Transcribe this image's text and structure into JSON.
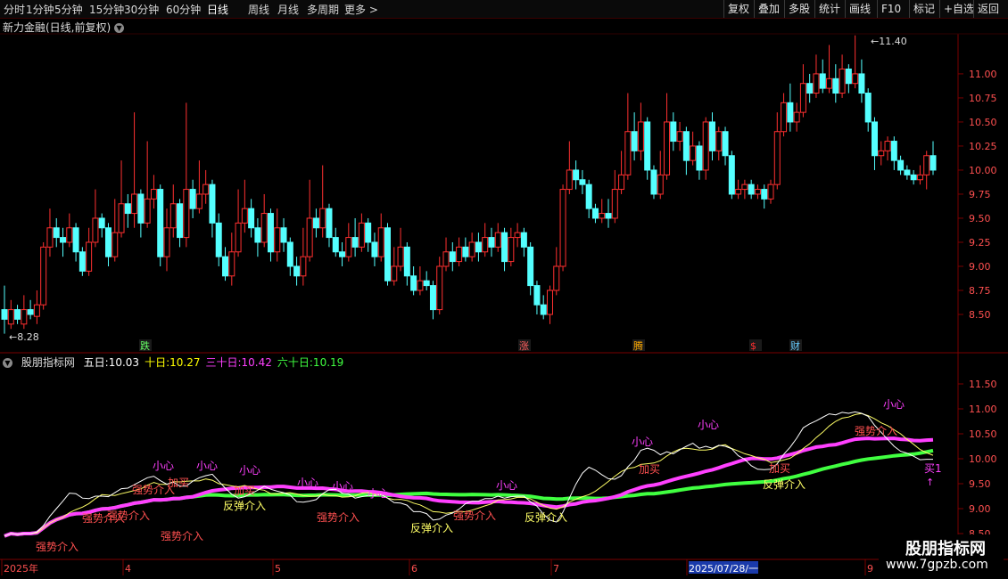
{
  "toolbar": {
    "tabs": [
      "分时",
      "1分钟",
      "5分钟",
      "15分钟",
      "30分钟",
      "60分钟",
      "日线",
      "周线",
      "月线",
      "多周期",
      "更多 >"
    ],
    "active_tab": "日线",
    "right_buttons": [
      "复权",
      "叠加",
      "多股",
      "统计",
      "画线",
      "F10",
      "标记",
      "+自选",
      "返回"
    ]
  },
  "chart_title": "新力金融(日线,前复权)",
  "indicator": {
    "name": "股朋指标网",
    "values": [
      {
        "label": "五日:",
        "value": "10.03",
        "color": "#ffffff"
      },
      {
        "label": "十日:",
        "value": "10.27",
        "color": "#ffff00"
      },
      {
        "label": "三十日:",
        "value": "10.42",
        "color": "#ff40ff"
      },
      {
        "label": "六十日:",
        "value": "10.19",
        "color": "#40ff40"
      }
    ]
  },
  "colors": {
    "up": "#ff3030",
    "down": "#54ffff",
    "ma5": "#ffffff",
    "ma10": "#ffff66",
    "ma30": "#ff40ff",
    "ma60": "#40ff40",
    "axis": "#7a0000"
  },
  "price_axis": [
    "11.00",
    "10.75",
    "10.50",
    "10.25",
    "10.00",
    "9.75",
    "9.50",
    "9.25",
    "9.00",
    "8.75",
    "8.50"
  ],
  "ind_axis": [
    "11.50",
    "11.00",
    "10.50",
    "10.00",
    "9.50",
    "9.00",
    "8.50"
  ],
  "max_label": "11.40",
  "min_label": "8.28",
  "events": [
    "跌",
    "涨",
    "腾",
    "$",
    "财"
  ],
  "date_axis": [
    "2025年",
    "4",
    "5",
    "6",
    "7",
    "2025/07/28/一",
    "9"
  ],
  "signals": {
    "strong": "强势介入",
    "rebound": "反弹介入",
    "add": "加买",
    "careful": "小心",
    "buy": "买1"
  },
  "brand": {
    "name": "股朋指标网",
    "url": "www.7gpzb.com"
  },
  "chart_data": {
    "type": "candlestick",
    "ylim": [
      8.3,
      11.5
    ],
    "candles": [
      [
        8.55,
        8.45,
        8.8,
        8.3
      ],
      [
        8.4,
        8.55,
        8.65,
        8.35
      ],
      [
        8.55,
        8.45,
        8.6,
        8.4
      ],
      [
        8.4,
        8.55,
        8.7,
        8.35
      ],
      [
        8.55,
        8.5,
        8.65,
        8.45
      ],
      [
        8.48,
        8.6,
        8.75,
        8.4
      ],
      [
        8.6,
        9.2,
        9.25,
        8.55
      ],
      [
        9.2,
        9.4,
        9.6,
        9.1
      ],
      [
        9.4,
        9.3,
        9.5,
        9.2
      ],
      [
        9.3,
        9.25,
        9.4,
        9.1
      ],
      [
        9.25,
        9.4,
        9.55,
        9.2
      ],
      [
        9.4,
        9.15,
        9.45,
        9.05
      ],
      [
        9.15,
        8.95,
        9.2,
        8.9
      ],
      [
        8.95,
        9.25,
        9.4,
        8.9
      ],
      [
        9.25,
        9.5,
        9.8,
        9.2
      ],
      [
        9.5,
        9.4,
        9.55,
        9.3
      ],
      [
        9.4,
        9.1,
        9.45,
        9.0
      ],
      [
        9.1,
        9.35,
        9.7,
        9.05
      ],
      [
        9.35,
        9.65,
        10.1,
        9.3
      ],
      [
        9.65,
        9.55,
        9.75,
        9.4
      ],
      [
        9.55,
        9.75,
        10.6,
        9.4
      ],
      [
        9.75,
        9.45,
        9.8,
        9.3
      ],
      [
        9.45,
        9.7,
        10.3,
        9.4
      ],
      [
        9.7,
        9.8,
        9.95,
        9.6
      ],
      [
        9.8,
        9.1,
        9.85,
        9.0
      ],
      [
        9.1,
        9.4,
        9.6,
        8.95
      ],
      [
        9.4,
        9.65,
        9.85,
        9.3
      ],
      [
        9.65,
        9.3,
        9.7,
        9.2
      ],
      [
        9.3,
        9.8,
        10.7,
        9.2
      ],
      [
        9.8,
        9.6,
        9.9,
        9.5
      ],
      [
        9.6,
        9.75,
        10.1,
        9.55
      ],
      [
        9.75,
        9.85,
        10.0,
        9.65
      ],
      [
        9.85,
        9.45,
        9.9,
        9.3
      ],
      [
        9.45,
        9.1,
        9.55,
        9.0
      ],
      [
        9.1,
        8.9,
        9.2,
        8.85
      ],
      [
        8.9,
        9.15,
        9.35,
        8.8
      ],
      [
        9.15,
        9.45,
        9.8,
        9.1
      ],
      [
        9.45,
        9.6,
        9.9,
        9.35
      ],
      [
        9.6,
        9.4,
        9.7,
        9.3
      ],
      [
        9.4,
        9.25,
        9.5,
        9.1
      ],
      [
        9.25,
        9.55,
        9.75,
        9.2
      ],
      [
        9.55,
        9.15,
        9.6,
        9.05
      ],
      [
        9.15,
        9.4,
        9.6,
        9.05
      ],
      [
        9.4,
        9.25,
        9.5,
        9.15
      ],
      [
        9.25,
        9.0,
        9.3,
        8.9
      ],
      [
        9.0,
        8.9,
        9.1,
        8.8
      ],
      [
        8.9,
        9.1,
        9.4,
        8.8
      ],
      [
        9.1,
        9.5,
        9.9,
        9.05
      ],
      [
        9.5,
        9.4,
        9.6,
        9.3
      ],
      [
        9.4,
        9.6,
        10.05,
        9.3
      ],
      [
        9.6,
        9.3,
        9.65,
        9.2
      ],
      [
        9.3,
        9.15,
        9.4,
        9.1
      ],
      [
        9.15,
        9.1,
        9.25,
        9.0
      ],
      [
        9.1,
        9.3,
        9.45,
        9.05
      ],
      [
        9.3,
        9.2,
        9.5,
        9.1
      ],
      [
        9.2,
        9.45,
        9.55,
        9.15
      ],
      [
        9.45,
        9.25,
        9.5,
        9.15
      ],
      [
        9.25,
        9.1,
        9.35,
        9.0
      ],
      [
        9.1,
        9.4,
        9.55,
        9.05
      ],
      [
        9.4,
        8.85,
        9.45,
        8.8
      ],
      [
        8.85,
        9.0,
        9.2,
        8.8
      ],
      [
        9.0,
        9.2,
        9.4,
        8.95
      ],
      [
        9.2,
        8.9,
        9.25,
        8.8
      ],
      [
        8.9,
        8.75,
        9.0,
        8.7
      ],
      [
        8.75,
        8.85,
        9.0,
        8.7
      ],
      [
        8.85,
        8.8,
        8.95,
        8.75
      ],
      [
        8.8,
        8.55,
        8.85,
        8.45
      ],
      [
        8.55,
        9.0,
        9.1,
        8.5
      ],
      [
        9.0,
        9.15,
        9.3,
        8.95
      ],
      [
        9.15,
        9.05,
        9.25,
        8.95
      ],
      [
        9.05,
        9.2,
        9.3,
        9.0
      ],
      [
        9.2,
        9.1,
        9.3,
        9.05
      ],
      [
        9.1,
        9.25,
        9.35,
        9.05
      ],
      [
        9.25,
        9.15,
        9.35,
        9.05
      ],
      [
        9.15,
        9.3,
        9.45,
        9.1
      ],
      [
        9.3,
        9.2,
        9.4,
        9.1
      ],
      [
        9.2,
        9.35,
        9.45,
        9.15
      ],
      [
        9.35,
        9.05,
        9.4,
        8.95
      ],
      [
        9.05,
        9.3,
        9.4,
        9.0
      ],
      [
        9.3,
        9.35,
        9.45,
        9.2
      ],
      [
        9.35,
        9.2,
        9.4,
        9.1
      ],
      [
        9.2,
        8.8,
        9.25,
        8.7
      ],
      [
        8.8,
        8.6,
        8.85,
        8.5
      ],
      [
        8.6,
        8.5,
        8.7,
        8.45
      ],
      [
        8.5,
        8.75,
        8.8,
        8.4
      ],
      [
        8.75,
        9.0,
        9.2,
        8.7
      ],
      [
        9.0,
        9.8,
        9.85,
        8.95
      ],
      [
        9.8,
        10.0,
        10.3,
        9.75
      ],
      [
        10.0,
        9.9,
        10.1,
        9.8
      ],
      [
        9.9,
        9.85,
        10.0,
        9.75
      ],
      [
        9.85,
        9.6,
        9.9,
        9.5
      ],
      [
        9.6,
        9.5,
        9.65,
        9.45
      ],
      [
        9.5,
        9.55,
        9.7,
        9.45
      ],
      [
        9.55,
        9.5,
        9.7,
        9.4
      ],
      [
        9.5,
        9.8,
        10.0,
        9.45
      ],
      [
        9.8,
        9.95,
        10.2,
        9.75
      ],
      [
        9.95,
        10.4,
        10.8,
        9.9
      ],
      [
        10.4,
        10.2,
        10.6,
        10.1
      ],
      [
        10.2,
        10.5,
        10.7,
        10.1
      ],
      [
        10.5,
        10.0,
        10.55,
        9.9
      ],
      [
        10.0,
        9.75,
        10.05,
        9.7
      ],
      [
        9.75,
        9.95,
        10.2,
        9.7
      ],
      [
        9.95,
        10.5,
        10.8,
        9.9
      ],
      [
        10.5,
        10.3,
        10.6,
        10.2
      ],
      [
        10.3,
        10.4,
        10.5,
        10.2
      ],
      [
        10.4,
        10.1,
        10.45,
        9.95
      ],
      [
        10.1,
        10.25,
        10.4,
        10.05
      ],
      [
        10.25,
        10.0,
        10.3,
        9.9
      ],
      [
        10.0,
        10.5,
        10.55,
        9.9
      ],
      [
        10.5,
        10.2,
        10.6,
        10.1
      ],
      [
        10.2,
        10.4,
        10.45,
        10.1
      ],
      [
        10.4,
        10.15,
        10.45,
        10.05
      ],
      [
        10.15,
        9.75,
        10.2,
        9.7
      ],
      [
        9.75,
        9.8,
        9.9,
        9.7
      ],
      [
        9.8,
        9.85,
        9.9,
        9.7
      ],
      [
        9.85,
        9.75,
        9.9,
        9.7
      ],
      [
        9.75,
        9.8,
        9.85,
        9.7
      ],
      [
        9.8,
        9.7,
        9.85,
        9.6
      ],
      [
        9.7,
        9.85,
        9.9,
        9.65
      ],
      [
        9.85,
        10.4,
        10.6,
        9.8
      ],
      [
        10.4,
        10.7,
        10.8,
        10.35
      ],
      [
        10.7,
        10.5,
        10.9,
        10.4
      ],
      [
        10.5,
        10.6,
        10.7,
        10.4
      ],
      [
        10.6,
        10.9,
        11.1,
        10.55
      ],
      [
        10.9,
        10.8,
        11.0,
        10.7
      ],
      [
        10.8,
        11.0,
        11.2,
        10.75
      ],
      [
        11.0,
        10.85,
        11.15,
        10.8
      ],
      [
        10.85,
        10.95,
        11.3,
        10.8
      ],
      [
        10.95,
        10.8,
        11.1,
        10.7
      ],
      [
        10.8,
        11.05,
        11.2,
        10.75
      ],
      [
        11.05,
        10.9,
        11.1,
        10.8
      ],
      [
        10.9,
        11.0,
        11.4,
        10.85
      ],
      [
        11.0,
        10.8,
        11.15,
        10.7
      ],
      [
        10.8,
        10.5,
        10.85,
        10.4
      ],
      [
        10.5,
        10.15,
        10.55,
        10.0
      ],
      [
        10.15,
        10.2,
        10.3,
        10.05
      ],
      [
        10.2,
        10.3,
        10.35,
        10.1
      ],
      [
        10.3,
        10.1,
        10.35,
        10.0
      ],
      [
        10.1,
        10.0,
        10.15,
        9.95
      ],
      [
        10.0,
        9.95,
        10.05,
        9.9
      ],
      [
        9.95,
        9.9,
        10.0,
        9.85
      ],
      [
        9.9,
        9.95,
        10.05,
        9.85
      ],
      [
        9.95,
        10.15,
        10.2,
        9.8
      ],
      [
        10.15,
        10.0,
        10.3,
        9.95
      ]
    ]
  }
}
